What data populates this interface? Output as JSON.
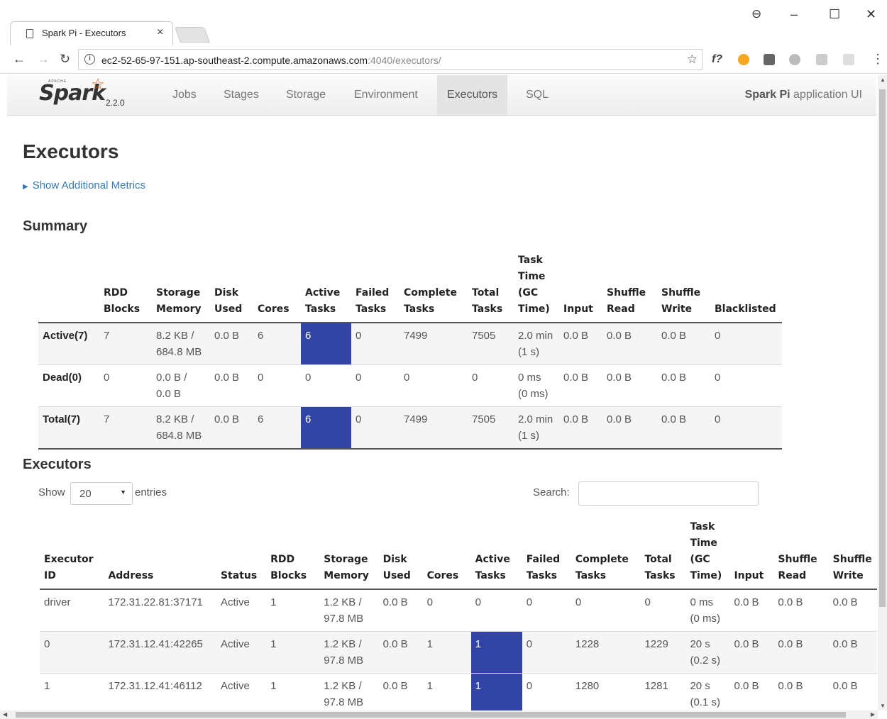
{
  "browser": {
    "tab_title": "Spark Pi - Executors",
    "tab_close": "×",
    "url_main": "ec2-52-65-97-151.ap-southeast-2.compute.amazonaws.com",
    "url_rest": ":4040/executors/",
    "account_icon": "account-icon",
    "minimize": "–",
    "maximize": "☐",
    "close": "✕"
  },
  "navbar": {
    "logo": "Spark",
    "logo_apache": "APACHE",
    "version": "2.2.0",
    "links": [
      "Jobs",
      "Stages",
      "Storage",
      "Environment",
      "Executors",
      "SQL"
    ],
    "active_link": "Executors",
    "app_name_bold": "Spark Pi",
    "app_name_rest": " application UI"
  },
  "page": {
    "title": "Executors",
    "additional_metrics": "Show Additional Metrics",
    "summary_heading": "Summary",
    "executors_heading": "Executors"
  },
  "summary": {
    "headers": [
      "",
      "RDD Blocks",
      "Storage Memory",
      "Disk Used",
      "Cores",
      "Active Tasks",
      "Failed Tasks",
      "Complete Tasks",
      "Total Tasks",
      "Task Time (GC Time)",
      "Input",
      "Shuffle Read",
      "Shuffle Write",
      "Blacklisted"
    ],
    "rows": [
      {
        "label": "Active(7)",
        "rdd": "7",
        "storage_1": "8.2 KB /",
        "storage_2": "684.8 MB",
        "disk": "0.0 B",
        "cores": "6",
        "active": "6",
        "failed": "0",
        "complete": "7499",
        "total": "7505",
        "time_1": "2.0 min",
        "time_2": "(1 s)",
        "input": "0.0 B",
        "shuffle_read": "0.0 B",
        "shuffle_write": "0.0 B",
        "blacklisted": "0"
      },
      {
        "label": "Dead(0)",
        "rdd": "0",
        "storage_1": "0.0 B /",
        "storage_2": "0.0 B",
        "disk": "0.0 B",
        "cores": "0",
        "active": "0",
        "failed": "0",
        "complete": "0",
        "total": "0",
        "time_1": "0 ms",
        "time_2": "(0 ms)",
        "input": "0.0 B",
        "shuffle_read": "0.0 B",
        "shuffle_write": "0.0 B",
        "blacklisted": "0"
      },
      {
        "label": "Total(7)",
        "rdd": "7",
        "storage_1": "8.2 KB /",
        "storage_2": "684.8 MB",
        "disk": "0.0 B",
        "cores": "6",
        "active": "6",
        "failed": "0",
        "complete": "7499",
        "total": "7505",
        "time_1": "2.0 min",
        "time_2": "(1 s)",
        "input": "0.0 B",
        "shuffle_read": "0.0 B",
        "shuffle_write": "0.0 B",
        "blacklisted": "0"
      }
    ]
  },
  "datatable": {
    "show_label": "Show",
    "page_size": "20",
    "entries_label": "entries",
    "search_label": "Search:",
    "search_value": ""
  },
  "executors": {
    "headers": [
      "Executor ID",
      "Address",
      "Status",
      "RDD Blocks",
      "Storage Memory",
      "Disk Used",
      "Cores",
      "Active Tasks",
      "Failed Tasks",
      "Complete Tasks",
      "Total Tasks",
      "Task Time (GC Time)",
      "Input",
      "Shuffle Read",
      "Shuffle Write"
    ],
    "rows": [
      {
        "id": "driver",
        "address": "172.31.22.81:37171",
        "status": "Active",
        "rdd": "1",
        "storage_1": "1.2 KB /",
        "storage_2": "97.8 MB",
        "disk": "0.0 B",
        "cores": "0",
        "active": "0",
        "failed": "0",
        "complete": "0",
        "total": "0",
        "time_1": "0 ms",
        "time_2": "(0 ms)",
        "input": "0.0 B",
        "shuffle_read": "0.0 B",
        "shuffle_write": "0.0 B"
      },
      {
        "id": "0",
        "address": "172.31.12.41:42265",
        "status": "Active",
        "rdd": "1",
        "storage_1": "1.2 KB /",
        "storage_2": "97.8 MB",
        "disk": "0.0 B",
        "cores": "1",
        "active": "1",
        "failed": "0",
        "complete": "1228",
        "total": "1229",
        "time_1": "20 s",
        "time_2": "(0.2 s)",
        "input": "0.0 B",
        "shuffle_read": "0.0 B",
        "shuffle_write": "0.0 B"
      },
      {
        "id": "1",
        "address": "172.31.12.41:46112",
        "status": "Active",
        "rdd": "1",
        "storage_1": "1.2 KB /",
        "storage_2": "97.8 MB",
        "disk": "0.0 B",
        "cores": "1",
        "active": "1",
        "failed": "0",
        "complete": "1280",
        "total": "1281",
        "time_1": "20 s",
        "time_2": "(0.1 s)",
        "input": "0.0 B",
        "shuffle_read": "0.0 B",
        "shuffle_write": "0.0 B"
      }
    ]
  },
  "colors": {
    "active_task_highlight": "#3245a6",
    "link": "#337ab7",
    "spark_orange": "#e25a1c"
  }
}
